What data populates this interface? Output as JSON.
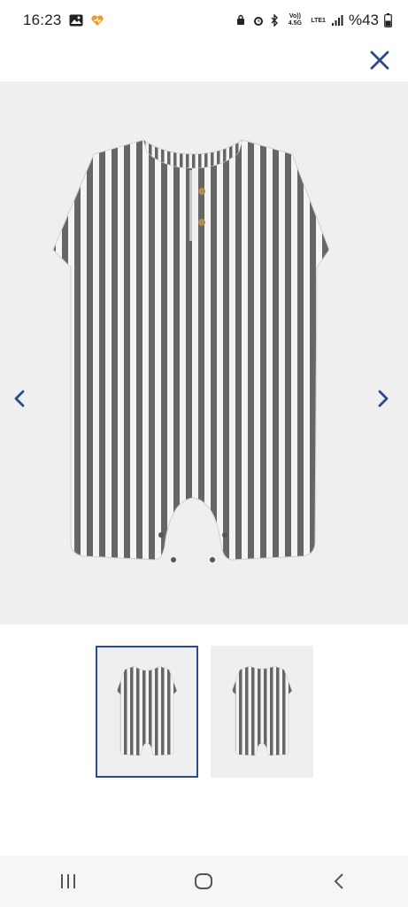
{
  "status_bar": {
    "time": "16:23",
    "network_volte": "Vo)) 4.5G",
    "network_lte": "LTE1",
    "battery": "%43"
  },
  "icons": {
    "close": "close-icon",
    "prev": "chevron-left-icon",
    "next": "chevron-right-icon",
    "nav_recent": "recent-apps-icon",
    "nav_home": "home-icon",
    "nav_back": "back-icon"
  },
  "colors": {
    "accent": "#2b4a8f",
    "image_bg": "#efefef",
    "stripe_dark": "#6a6a6a",
    "stripe_light": "#f2f2f2"
  },
  "gallery": {
    "selected_index": 0,
    "thumbnails": [
      "front",
      "back"
    ]
  }
}
